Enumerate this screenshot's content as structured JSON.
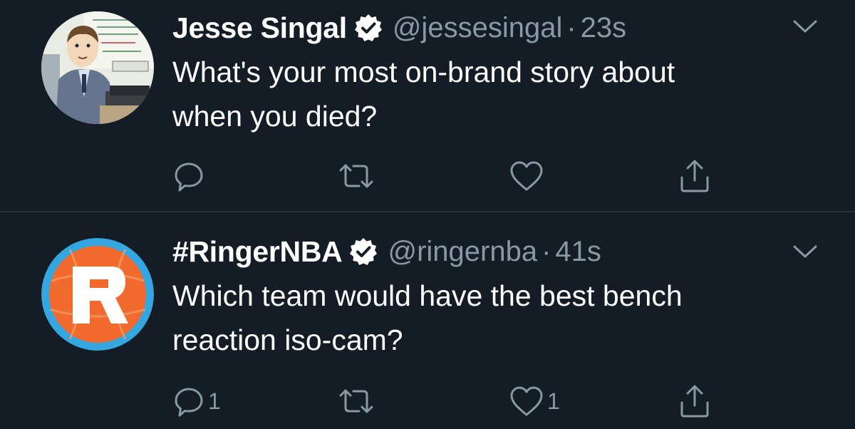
{
  "tweets": [
    {
      "name": "Jesse Singal",
      "handle": "@jessesingal",
      "separator": "·",
      "time": "23s",
      "text_lines": [
        "What's your most on-brand story about",
        "when you died?"
      ],
      "reply_count": "",
      "retweet_count": "",
      "like_count": ""
    },
    {
      "name": "#RingerNBA",
      "handle": "@ringernba",
      "separator": "·",
      "time": "41s",
      "text_lines": [
        "Which team would have the best bench",
        "reaction iso-cam?"
      ],
      "reply_count": "1",
      "retweet_count": "",
      "like_count": "1",
      "avatar_letter": "R"
    }
  ],
  "colors": {
    "background": "#141d26",
    "text_primary": "#ffffff",
    "text_secondary": "#8899a6",
    "divider": "#2a3440",
    "ringer_orange": "#f26a2e",
    "ringer_blue": "#35a7e0"
  },
  "icons": {
    "verified": "verified-badge-icon",
    "chevron": "chevron-down-icon",
    "reply": "reply-icon",
    "retweet": "retweet-icon",
    "like": "heart-icon",
    "share": "share-icon"
  }
}
